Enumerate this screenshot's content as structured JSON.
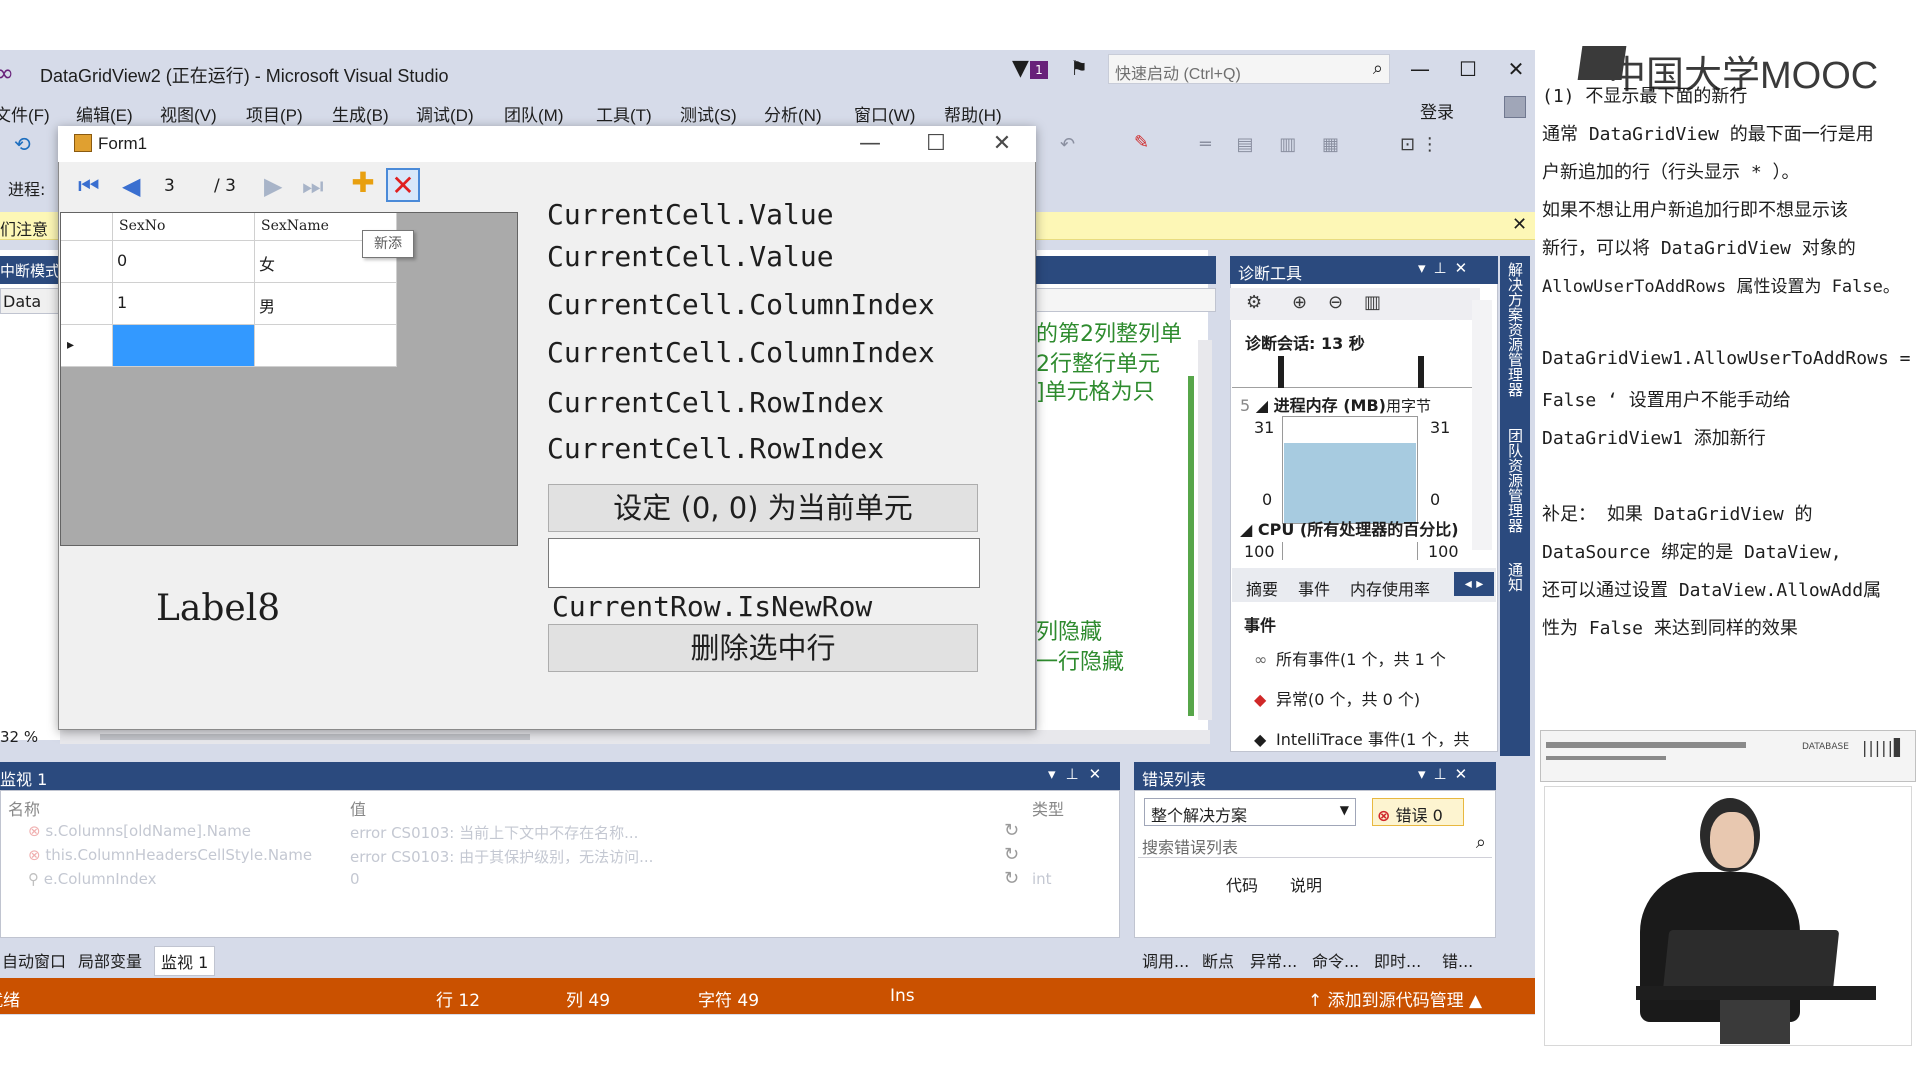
{
  "vs": {
    "title": "DataGridView2 (正在运行) - Microsoft Visual Studio",
    "quick_launch_placeholder": "快速启动 (Ctrl+Q)",
    "filter_badge": "1",
    "menu": [
      "文件(F)",
      "编辑(E)",
      "视图(V)",
      "项目(P)",
      "生成(B)",
      "调试(D)",
      "团队(M)",
      "工具(T)",
      "测试(S)",
      "分析(N)",
      "窗口(W)",
      "帮助(H)"
    ],
    "login": "登录",
    "progress_label": "进程:",
    "infobar_text": "们注意",
    "left_mode": "中断模式",
    "left_data": "Data",
    "zoom": "32 %",
    "code_lines": [
      "的第2列整列单",
      "2行整行单元",
      "]单元格为只",
      "列隐藏",
      "一行隐藏"
    ]
  },
  "form1": {
    "title": "Form1",
    "nav": {
      "position": "3",
      "count": "/ 3"
    },
    "grid": {
      "columns": [
        "SexNo",
        "SexName"
      ],
      "rows": [
        [
          "0",
          "女"
        ],
        [
          "1",
          "男"
        ],
        [
          "",
          ""
        ]
      ],
      "tooltip": "新添"
    },
    "label8": "Label8",
    "prop_labels": [
      "CurrentCell.Value",
      "CurrentCell.Value",
      "CurrentCell.ColumnIndex",
      "CurrentCell.ColumnIndex",
      "CurrentCell.RowIndex",
      "CurrentCell.RowIndex"
    ],
    "set_current_button": "设定 (0, 0) 为当前单元",
    "is_new_row_label": "CurrentRow.IsNewRow",
    "delete_button": "删除选中行"
  },
  "diag": {
    "title": "诊断工具",
    "session": "诊断会话: 13 秒",
    "memory_title": "进程内存 (MB)",
    "memory_unit": "用字节",
    "memory_prefix": "5",
    "memory_max_left": "31",
    "memory_max_right": "31",
    "memory_min_left": "0",
    "memory_min_right": "0",
    "memory_level": 0.75,
    "cpu_title": "CPU (所有处理器的百分比)",
    "cpu_max_left": "100",
    "cpu_max_right": "100",
    "tabs": [
      "摘要",
      "事件",
      "内存使用率"
    ],
    "events_heading": "事件",
    "events": [
      {
        "icon": "∞",
        "text": "所有事件(1 个，共 1 个"
      },
      {
        "icon": "◆",
        "text": "异常(0 个，共 0 个)"
      },
      {
        "icon": "◆",
        "text": "IntelliTrace 事件(1 个，共"
      }
    ]
  },
  "vtabs": [
    "解决方案资源管理器",
    "团队资源管理器",
    "通知"
  ],
  "watch": {
    "title": "监视 1",
    "col_name": "名称",
    "col_value": "值",
    "col_type": "类型",
    "rows": [
      {
        "name": "s.Columns[oldName].Name",
        "value": "error CS0103: 当前上下文中不存在名称..."
      },
      {
        "name": "this.ColumnHeadersCellStyle.Name",
        "value": "error CS0103: 由于其保护级别，无法访问..."
      },
      {
        "name": "e.ColumnIndex",
        "value": "0",
        "type": "int"
      }
    ],
    "tabs": [
      "自动窗口",
      "局部变量",
      "监视 1"
    ]
  },
  "errors": {
    "title": "错误列表",
    "scope": "整个解决方案",
    "count": "错误 0",
    "search_placeholder": "搜索错误列表",
    "col_code": "代码",
    "col_desc": "说明",
    "tabs": [
      "调用...",
      "断点",
      "异常...",
      "命令...",
      "即时...",
      "错..."
    ]
  },
  "status": {
    "ready": "就绪",
    "line": "行 12",
    "col": "列 49",
    "char": "字符 49",
    "mode": "Ins",
    "source_control": "添加到源代码管理"
  },
  "mooc": {
    "logo_text": "中国大学MOOC",
    "notes": [
      "(1) 不显示最下面的新行",
      "通常 DataGridView 的最下面一行是用",
      "户新追加的行（行头显示 * ）。",
      "如果不想让用户新追加行即不想显示该",
      "新行，可以将 DataGridView 对象的",
      "AllowUserToAddRows 属性设置为 False。",
      "",
      " DataGridView1.AllowUserToAddRows =",
      "False  ‘ 设置用户不能手动给",
      "DataGridView1 添加新行",
      "",
      "补足： 如果 DataGridView 的",
      " DataSource 绑定的是 DataView,",
      "还可以通过设置 DataView.AllowAdd属",
      "性为 False 来达到同样的效果"
    ],
    "video_label": "DATABASE"
  }
}
